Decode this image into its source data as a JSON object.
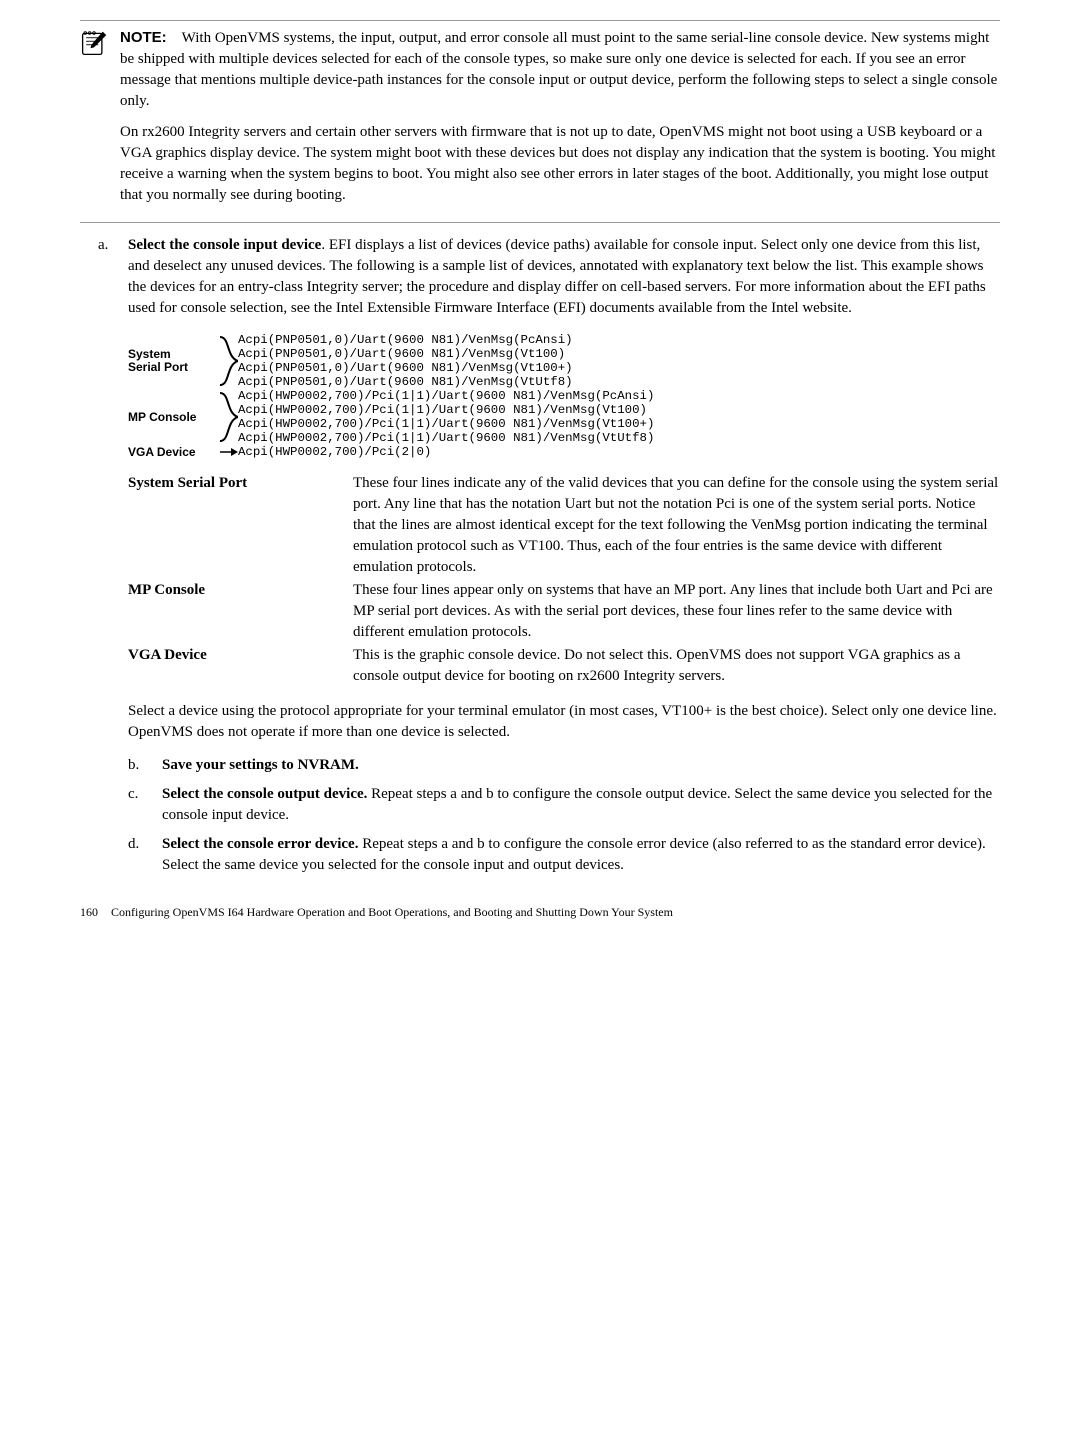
{
  "note": {
    "label": "NOTE:",
    "para1": "With OpenVMS systems, the input, output, and error console all must point to the same serial-line console device. New systems might be shipped with multiple devices selected for each of the console types, so make sure only one device is selected for each. If you see an error message that mentions multiple device-path instances for the console input or output device, perform the following steps to select a single console only.",
    "para2": "On rx2600 Integrity servers and certain other servers with firmware that is not up to date, OpenVMS might not boot using a USB keyboard or a VGA graphics display device. The system might boot with these devices but does not display any indication that the system is booting. You might receive a warning when the system begins to boot. You might also see other errors in later stages of the boot. Additionally, you might lose output that you normally see during booting."
  },
  "step_a": {
    "marker": "a.",
    "bold": "Select the console input device",
    "text": ". EFI displays a list of devices (device paths) available for console input. Select only one device from this list, and deselect any unused devices. The following is a sample list of devices, annotated with explanatory text below the list. This example shows the devices for an entry-class Integrity server; the procedure and display differ on cell-based servers. For more information about the EFI paths used for console selection, see the Intel Extensible Firmware Interface (EFI) documents available from the Intel website."
  },
  "code_labels": {
    "system_serial_port": "System\nSerial Port",
    "mp_console": "MP Console",
    "vga_device": "VGA Device"
  },
  "code_lines": {
    "l1": "Acpi(PNP0501,0)/Uart(9600 N81)/VenMsg(PcAnsi)",
    "l2": "Acpi(PNP0501,0)/Uart(9600 N81)/VenMsg(Vt100)",
    "l3": "Acpi(PNP0501,0)/Uart(9600 N81)/VenMsg(Vt100+)",
    "l4": "Acpi(PNP0501,0)/Uart(9600 N81)/VenMsg(VtUtf8)",
    "l5": "Acpi(HWP0002,700)/Pci(1|1)/Uart(9600 N81)/VenMsg(PcAnsi)",
    "l6": "Acpi(HWP0002,700)/Pci(1|1)/Uart(9600 N81)/VenMsg(Vt100)",
    "l7": "Acpi(HWP0002,700)/Pci(1|1)/Uart(9600 N81)/VenMsg(Vt100+)",
    "l8": "Acpi(HWP0002,700)/Pci(1|1)/Uart(9600 N81)/VenMsg(VtUtf8)",
    "l9": "Acpi(HWP0002,700)/Pci(2|0)"
  },
  "defs": {
    "ssp": {
      "term": "System Serial Port",
      "desc": "These four lines indicate any of the valid devices that you can define for the console using the system serial port. Any line that has the notation Uart but not the notation Pci is one of the system serial ports. Notice that the lines are almost identical except for the text following the VenMsg portion indicating the terminal emulation protocol such as VT100. Thus, each of the four entries is the same device with different emulation protocols."
    },
    "mpc": {
      "term": "MP Console",
      "desc": "These four lines appear only on systems that have an MP port. Any lines that include both Uart and Pci are MP serial port devices. As with the serial port devices, these four lines refer to the same device with different emulation protocols."
    },
    "vga": {
      "term": "VGA Device",
      "desc": "This is the graphic console device. Do not select this. OpenVMS does not support VGA graphics as a console output device for booting on rx2600 Integrity servers."
    }
  },
  "select_para": "Select a device using the protocol appropriate for your terminal emulator (in most cases, VT100+ is the best choice). Select only one device line. OpenVMS does not operate if more than one device is selected.",
  "step_b": {
    "marker": "b.",
    "bold": "Save your settings to NVRAM."
  },
  "step_c": {
    "marker": "c.",
    "bold": "Select the console output device.",
    "text": " Repeat steps a and b to configure the console output device. Select the same device you selected for the console input device."
  },
  "step_d": {
    "marker": "d.",
    "bold": "Select the console error device.",
    "text": " Repeat steps a and b to configure the console error device (also referred to as the standard error device). Select the same device you selected for the console input and output devices."
  },
  "footer": {
    "page": "160",
    "text": "Configuring OpenVMS I64 Hardware Operation and Boot Operations, and Booting and Shutting Down Your System"
  }
}
